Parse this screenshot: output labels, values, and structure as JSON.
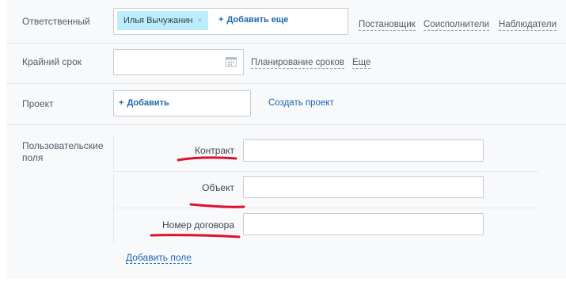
{
  "responsible": {
    "label": "Ответственный",
    "tag_name": "Илья Вычужанин",
    "tag_remove": "×",
    "add_more": "Добавить еще",
    "links": [
      "Постановщик",
      "Соисполнители",
      "Наблюдатели"
    ]
  },
  "deadline": {
    "label": "Крайний срок",
    "value": "",
    "planning_link": "Планирование сроков",
    "more_link": "Еще",
    "calendar_icon": "calendar-icon"
  },
  "project": {
    "label": "Проект",
    "add_label": "Добавить",
    "create_link": "Создать проект"
  },
  "user_fields": {
    "label": "Пользовательские поля",
    "fields": [
      {
        "label": "Контракт",
        "value": ""
      },
      {
        "label": "Объект",
        "value": ""
      },
      {
        "label": "Номер договора",
        "value": ""
      }
    ],
    "add_field_link": "Добавить поле",
    "annotation_color": "#e0102a"
  },
  "colors": {
    "link": "#2067b0",
    "tag_bg": "#bcedfc",
    "panel_bg": "#f8f9fa",
    "border": "#c6cdd3"
  }
}
